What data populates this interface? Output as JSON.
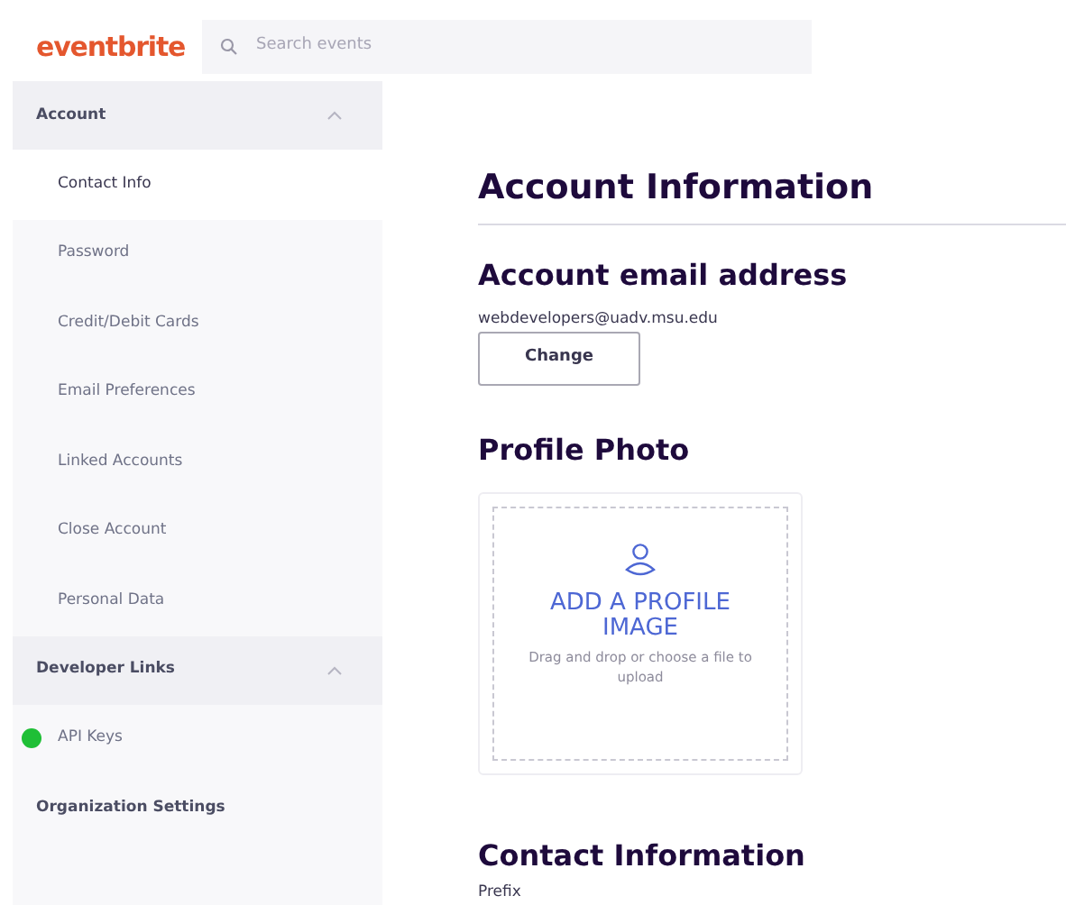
{
  "header": {
    "logo": "eventbrite",
    "search": {
      "placeholder": "Search events"
    }
  },
  "sidebar": {
    "groups": [
      {
        "label": "Account",
        "expanded": true,
        "items": [
          {
            "label": "Contact Info",
            "selected": true
          },
          {
            "label": "Password",
            "selected": false
          },
          {
            "label": "Credit/Debit Cards",
            "selected": false
          },
          {
            "label": "Email Preferences",
            "selected": false
          },
          {
            "label": "Linked Accounts",
            "selected": false
          },
          {
            "label": "Close Account",
            "selected": false
          },
          {
            "label": "Personal Data",
            "selected": false
          }
        ]
      },
      {
        "label": "Developer Links",
        "expanded": true,
        "items": [
          {
            "label": "API Keys",
            "selected": false,
            "color": "#1fbf36"
          }
        ]
      },
      {
        "label": "Organization Settings"
      }
    ]
  },
  "main": {
    "title": "Account Information",
    "email_section": {
      "heading": "Account email address",
      "email": "webdevelopers@uadv.msu.edu",
      "button": "Change"
    },
    "photo_section": {
      "heading": "Profile Photo",
      "upload_title": "ADD A PROFILE IMAGE",
      "upload_hint": "Drag and drop or choose a file to upload"
    },
    "contact_section": {
      "heading": "Contact Information",
      "field_label": "Prefix"
    }
  }
}
